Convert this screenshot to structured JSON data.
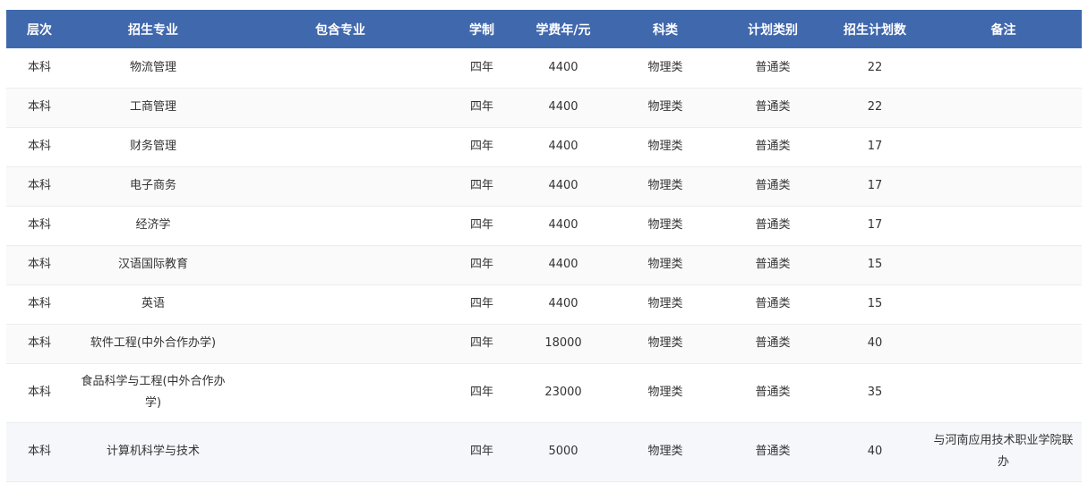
{
  "headers": [
    "层次",
    "招生专业",
    "包含专业",
    "学制",
    "学费年/元",
    "科类",
    "计划类别",
    "招生计划数",
    "备注"
  ],
  "rows": [
    {
      "level": "本科",
      "major": "物流管理",
      "includes": "",
      "duration": "四年",
      "tuition": "4400",
      "category": "物理类",
      "plan_type": "普通类",
      "plan_count": "22",
      "note": ""
    },
    {
      "level": "本科",
      "major": "工商管理",
      "includes": "",
      "duration": "四年",
      "tuition": "4400",
      "category": "物理类",
      "plan_type": "普通类",
      "plan_count": "22",
      "note": ""
    },
    {
      "level": "本科",
      "major": "财务管理",
      "includes": "",
      "duration": "四年",
      "tuition": "4400",
      "category": "物理类",
      "plan_type": "普通类",
      "plan_count": "17",
      "note": ""
    },
    {
      "level": "本科",
      "major": "电子商务",
      "includes": "",
      "duration": "四年",
      "tuition": "4400",
      "category": "物理类",
      "plan_type": "普通类",
      "plan_count": "17",
      "note": ""
    },
    {
      "level": "本科",
      "major": "经济学",
      "includes": "",
      "duration": "四年",
      "tuition": "4400",
      "category": "物理类",
      "plan_type": "普通类",
      "plan_count": "17",
      "note": ""
    },
    {
      "level": "本科",
      "major": "汉语国际教育",
      "includes": "",
      "duration": "四年",
      "tuition": "4400",
      "category": "物理类",
      "plan_type": "普通类",
      "plan_count": "15",
      "note": ""
    },
    {
      "level": "本科",
      "major": "英语",
      "includes": "",
      "duration": "四年",
      "tuition": "4400",
      "category": "物理类",
      "plan_type": "普通类",
      "plan_count": "15",
      "note": ""
    },
    {
      "level": "本科",
      "major": "软件工程(中外合作办学)",
      "includes": "",
      "duration": "四年",
      "tuition": "18000",
      "category": "物理类",
      "plan_type": "普通类",
      "plan_count": "40",
      "note": ""
    },
    {
      "level": "本科",
      "major": "食品科学与工程(中外合作办学)",
      "includes": "",
      "duration": "四年",
      "tuition": "23000",
      "category": "物理类",
      "plan_type": "普通类",
      "plan_count": "35",
      "note": ""
    },
    {
      "level": "本科",
      "major": "计算机科学与技术",
      "includes": "",
      "duration": "四年",
      "tuition": "5000",
      "category": "物理类",
      "plan_type": "普通类",
      "plan_count": "40",
      "note": "与河南应用技术职业学院联办"
    }
  ]
}
